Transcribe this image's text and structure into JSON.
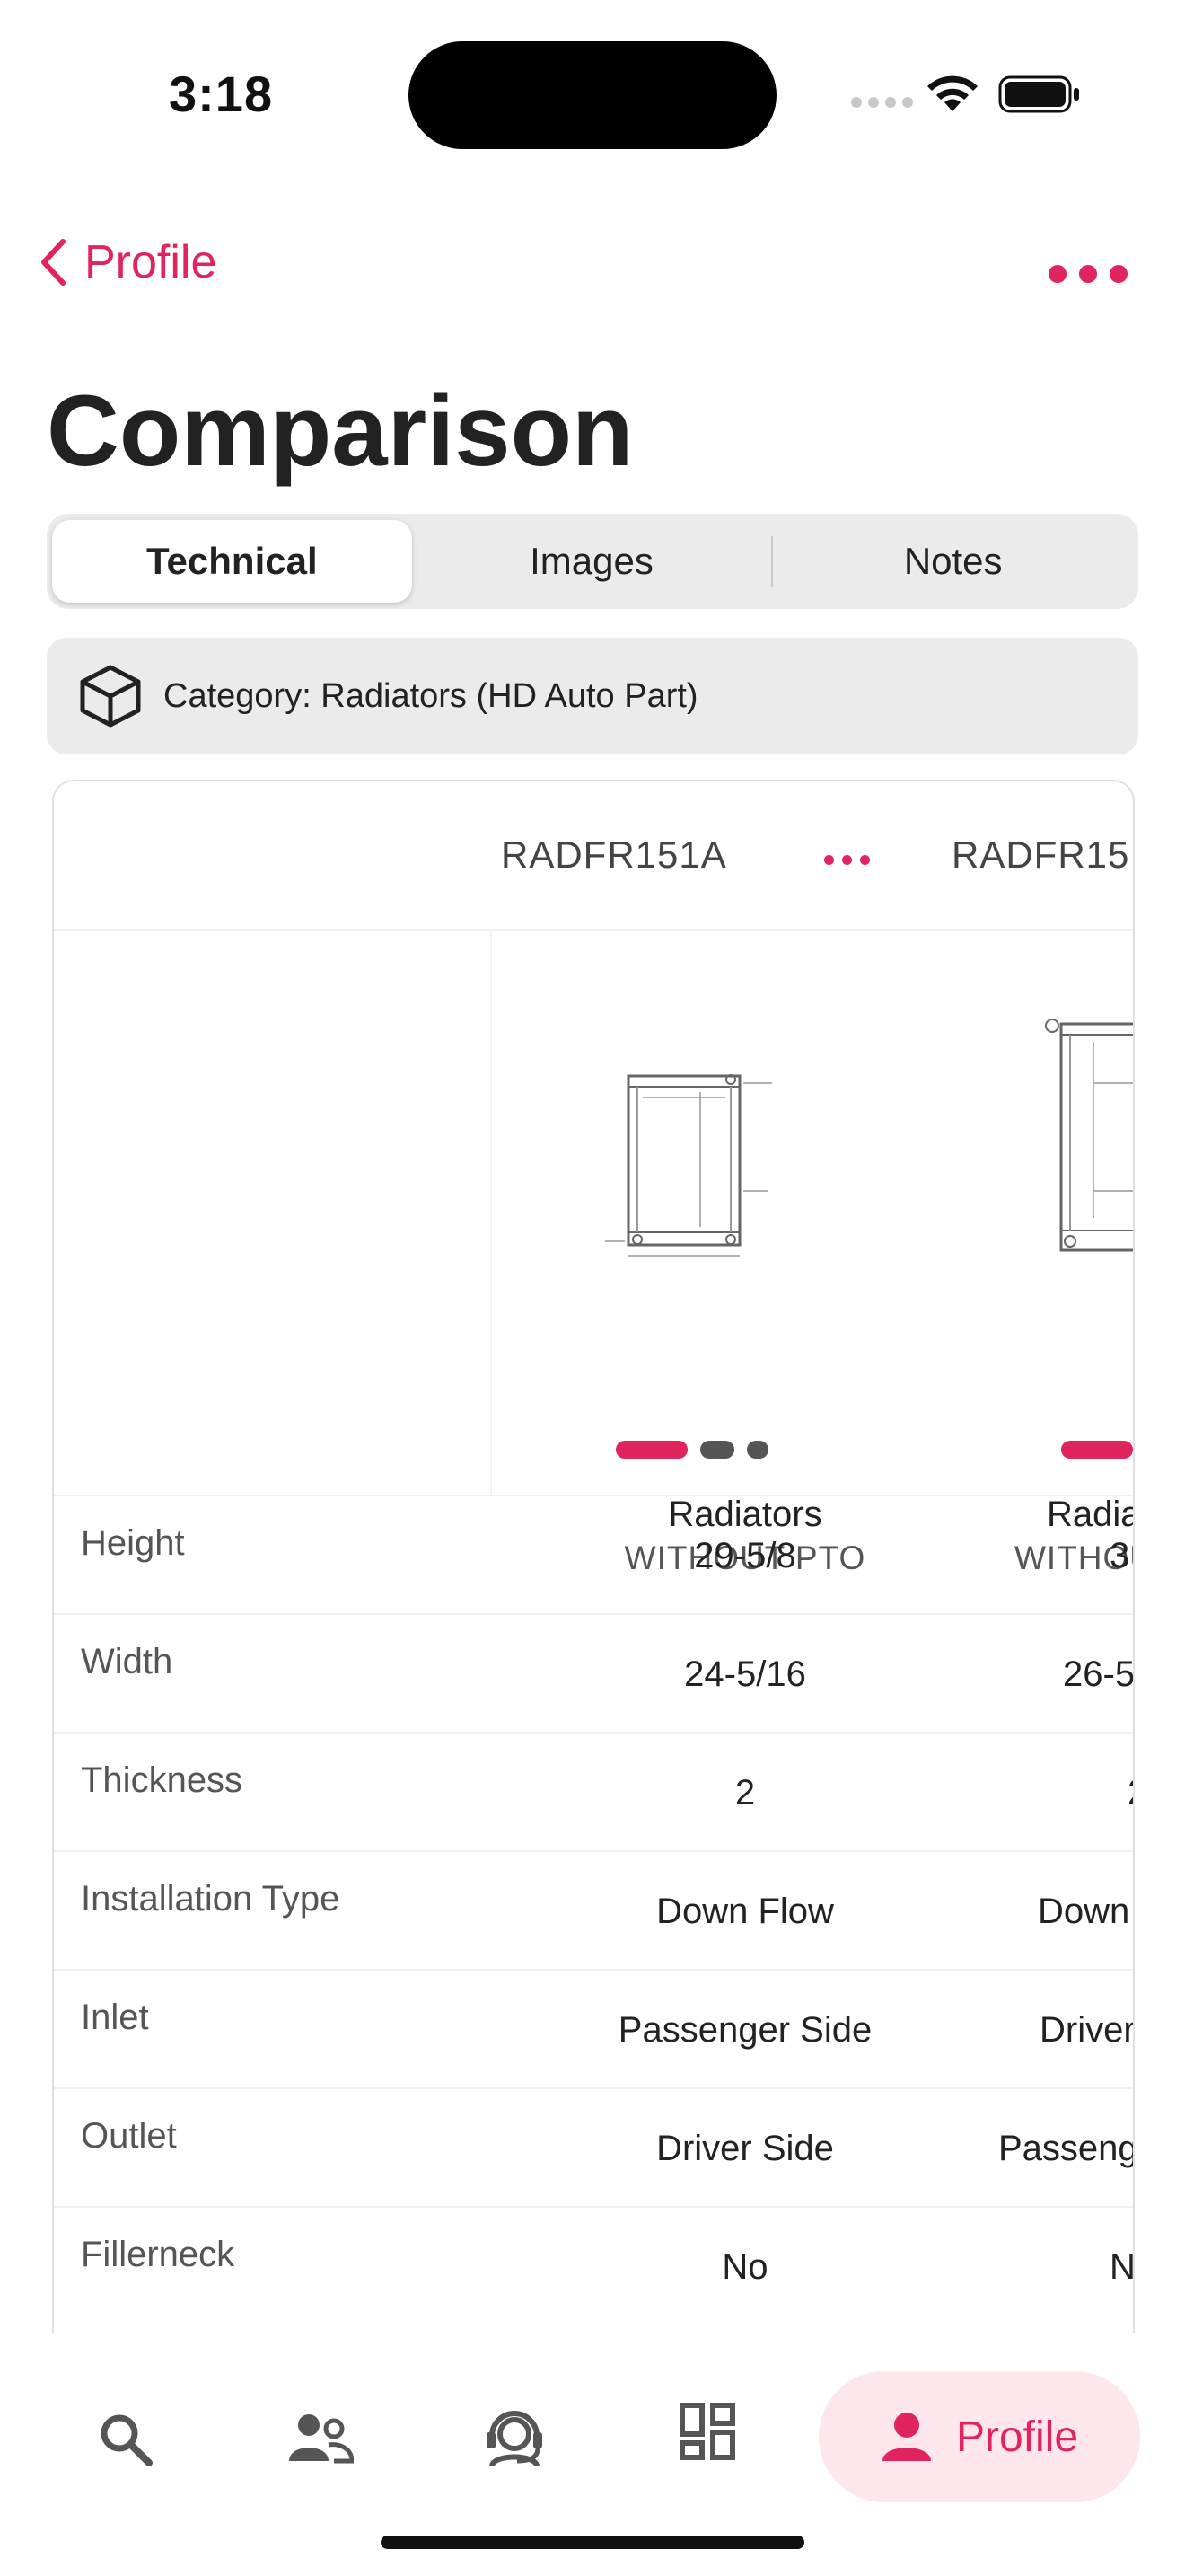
{
  "status": {
    "time": "3:18"
  },
  "nav": {
    "back_label": "Profile"
  },
  "title": "Comparison",
  "segments": [
    {
      "label": "Technical",
      "selected": true
    },
    {
      "label": "Images",
      "selected": false
    },
    {
      "label": "Notes",
      "selected": false
    }
  ],
  "category": {
    "text": "Category: Radiators (HD Auto Part)",
    "icon": "box-icon"
  },
  "products": [
    {
      "sku": "RADFR151A",
      "name": "Radiators",
      "subtitle": "WITHOUT PTO"
    },
    {
      "sku": "RADFR15",
      "name": "Radia",
      "subtitle": "WITHOU"
    }
  ],
  "specs": [
    {
      "label": "Height",
      "values": [
        "29-5/8",
        "3"
      ]
    },
    {
      "label": "Width",
      "values": [
        "24-5/16",
        "26-5"
      ]
    },
    {
      "label": "Thickness",
      "values": [
        "2",
        "2"
      ]
    },
    {
      "label": "Installation Type",
      "values": [
        "Down Flow",
        "Down"
      ]
    },
    {
      "label": "Inlet",
      "values": [
        "Passenger Side",
        "Driver"
      ]
    },
    {
      "label": "Outlet",
      "values": [
        "Driver Side",
        "Passeng"
      ]
    },
    {
      "label": "Fillerneck",
      "values": [
        "No",
        "N"
      ]
    }
  ],
  "tabbar": {
    "items": [
      {
        "icon": "search-icon"
      },
      {
        "icon": "people-icon"
      },
      {
        "icon": "support-agent-icon"
      },
      {
        "icon": "dashboard-icon"
      },
      {
        "icon": "person-icon",
        "label": "Profile",
        "selected": true
      }
    ]
  },
  "colors": {
    "accent": "#e0245e",
    "accent_soft": "#fde6ec",
    "segment_bg": "#ebebeb"
  }
}
